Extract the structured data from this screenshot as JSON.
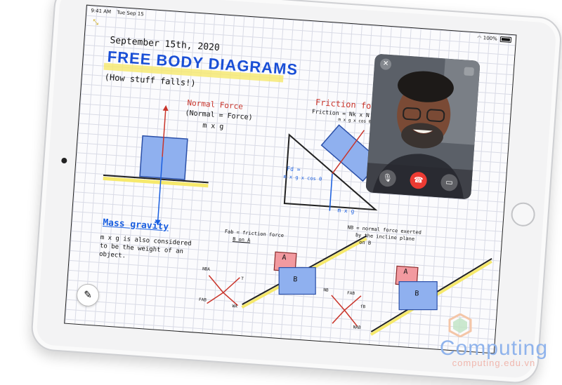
{
  "status_bar": {
    "time": "9:41 AM",
    "date": "Tue Sep 15",
    "battery": "100%"
  },
  "note": {
    "date": "September 15th, 2020",
    "title": "FREE BODY DIAGRAMS",
    "subtitle": "(How stuff falls!)",
    "normal_force_heading": "Normal Force",
    "normal_force_formula_1": "(Normal = Force)",
    "normal_force_formula_2": "m x g",
    "friction_heading": "Friction force",
    "friction_formula": "Friction = Nk x N",
    "friction_sub": "m x g x cos θ",
    "fd_label": "Fd =",
    "fd_formula": "m x g x cos θ",
    "mxg_label": "m x g",
    "mass_gravity_heading": "Mass gravity",
    "mass_gravity_text_1": "m x g is also considered",
    "mass_gravity_text_2": "to be the weight of an",
    "mass_gravity_text_3": "object.",
    "fab_note_1": "Fab = friction force",
    "fab_note_2": "B on A",
    "nb_note_1": "NB = normal force exerted",
    "nb_note_2": "by the incline plane",
    "nb_note_3": "on B",
    "block_a": "A",
    "block_b": "B",
    "vec_nba": "NBA",
    "vec_t": "T",
    "vec_fab": "FAB",
    "vec_wa": "WA",
    "vec_nb": "NB",
    "vec_fab2": "FAB",
    "vec_fb": "fB",
    "vec_nab": "NAB"
  },
  "facetime": {
    "close_label": "✕"
  },
  "watermark": {
    "title": "Computing",
    "url": "computing.edu.vn"
  }
}
